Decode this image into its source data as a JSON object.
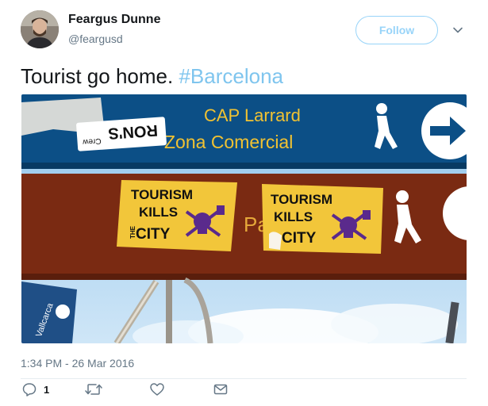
{
  "author": {
    "name": "Feargus Dunne",
    "handle": "@feargusd"
  },
  "follow_label": "Follow",
  "tweet": {
    "text": "Tourist go home.",
    "hashtag": "#Barcelona"
  },
  "photo_signs": {
    "blue_line1": "CAP Larrard",
    "blue_line2": "Zona Comercial",
    "sticker_rons": "RON'S",
    "sticker_crew": "Crew",
    "sticker1_line1": "TOURISM",
    "sticker1_line2": "KILLS",
    "sticker1_the": "THE",
    "sticker1_line3": "CITY",
    "sticker2_line1": "TOURISM",
    "sticker2_line2": "KILLS",
    "sticker2_line3": "CITY",
    "brown_partial": "Pa",
    "small_sign": "Vallcarca"
  },
  "timestamp": "1:34 PM - 26 Mar 2016",
  "actions": {
    "reply_count": "1"
  },
  "icons": {
    "reply": "reply-icon",
    "retweet": "retweet-icon",
    "like": "heart-icon",
    "dm": "envelope-icon",
    "menu": "chevron-down-icon"
  },
  "colors": {
    "accent": "#1da1f2",
    "hashtag": "#7fc5ee",
    "secondary_text": "#657786",
    "blue_sign": "#0c4f86",
    "brown_sign": "#7a2a12",
    "sticker": "#f2c63a",
    "sticker_ink": "#5a2a8c"
  }
}
